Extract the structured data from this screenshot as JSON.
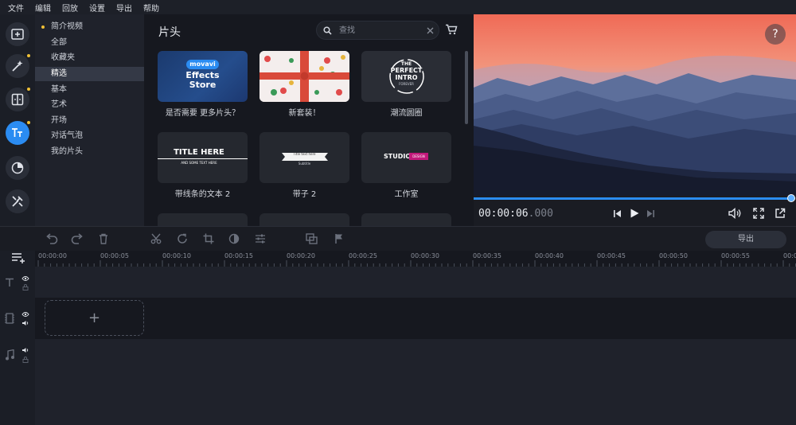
{
  "menu": [
    "文件",
    "编辑",
    "回放",
    "设置",
    "导出",
    "帮助"
  ],
  "categories": [
    {
      "label": "简介视频",
      "dot": true
    },
    {
      "label": "全部"
    },
    {
      "label": "收藏夹"
    },
    {
      "label": "精选",
      "selected": true
    },
    {
      "label": "基本"
    },
    {
      "label": "艺术"
    },
    {
      "label": "开场"
    },
    {
      "label": "对话气泡"
    },
    {
      "label": "我的片头"
    }
  ],
  "content": {
    "title": "片头",
    "search_placeholder": "查找"
  },
  "tiles": [
    {
      "label": "是否需要 更多片头？",
      "brand": "movavi",
      "line1": "Effects",
      "line2": "Store"
    },
    {
      "label": "新套装！"
    },
    {
      "label": "潮流圆圈",
      "line1": "THE",
      "line2": "PERFECT",
      "line3": "INTRO",
      "line4": "FOREVER"
    },
    {
      "label": "带线条的文本 2",
      "line1": "TITLE HERE",
      "line2": "AND SOME TEXT HERE"
    },
    {
      "label": "带子 2",
      "line1": "Title text here",
      "line2": "Subtitle"
    },
    {
      "label": "工作室",
      "line1": "STUDIO",
      "line2": "DESIGN"
    }
  ],
  "preview": {
    "help": "?",
    "timecode_main": "00:00:06",
    "timecode_ms": ".000",
    "progress": 1.0
  },
  "toolbar": {
    "export_label": "导出"
  },
  "ruler": [
    "00:00:00",
    "00:00:05",
    "00:00:10",
    "00:00:15",
    "00:00:20",
    "00:00:25",
    "00:00:30",
    "00:00:35",
    "00:00:40",
    "00:00:45",
    "00:00:50",
    "00:00:55",
    "00:0"
  ],
  "timeline": {
    "add_symbol": "+"
  },
  "colors": {
    "accent": "#2b8cf2",
    "highlight_dot": "#f0c036"
  }
}
